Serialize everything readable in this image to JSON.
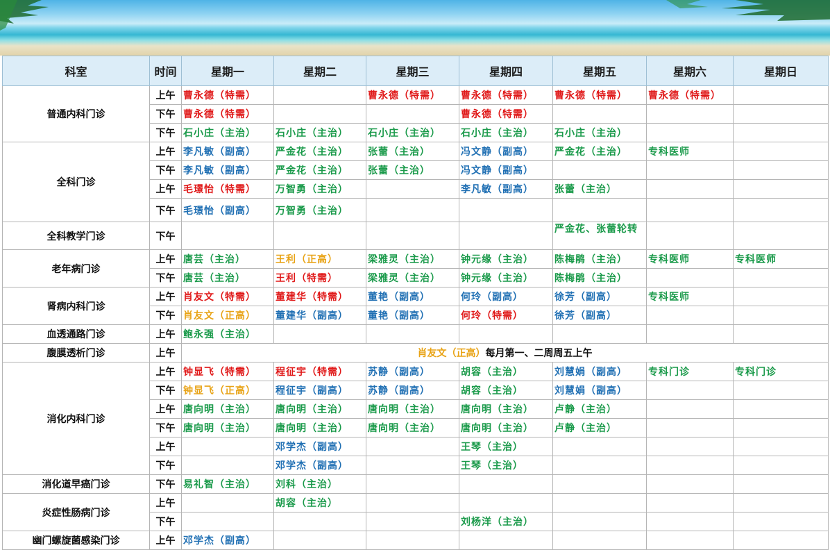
{
  "colors": {
    "red": "#e01818",
    "blue": "#1f6fb3",
    "green": "#1a9a4a",
    "orange": "#e8a315",
    "header_bg": "#dcedf8"
  },
  "headers": [
    "科室",
    "时间",
    "星期一",
    "星期二",
    "星期三",
    "星期四",
    "星期五",
    "星期六",
    "星期日"
  ],
  "rows": [
    {
      "dept": "普通内科门诊",
      "span": 3,
      "h": 27,
      "time": "上午",
      "cells": [
        {
          "t": "曹永德（特需）",
          "c": "red"
        },
        {
          "t": "",
          "c": ""
        },
        {
          "t": "曹永德（特需）",
          "c": "red"
        },
        {
          "t": "曹永德（特需）",
          "c": "red"
        },
        {
          "t": "曹永德（特需）",
          "c": "red"
        },
        {
          "t": "曹永德（特需）",
          "c": "red"
        },
        {
          "t": "",
          "c": ""
        }
      ]
    },
    {
      "h": 27,
      "time": "下午",
      "cells": [
        {
          "t": "曹永德（特需）",
          "c": "red"
        },
        {
          "t": "",
          "c": ""
        },
        {
          "t": "",
          "c": ""
        },
        {
          "t": "曹永德（特需）",
          "c": "red"
        },
        {
          "t": "",
          "c": ""
        },
        {
          "t": "",
          "c": ""
        },
        {
          "t": "",
          "c": ""
        }
      ]
    },
    {
      "h": 27,
      "time": "下午",
      "cells": [
        {
          "t": "石小庄（主治）",
          "c": "green"
        },
        {
          "t": "石小庄（主治）",
          "c": "green"
        },
        {
          "t": "石小庄（主治）",
          "c": "green"
        },
        {
          "t": "石小庄（主治）",
          "c": "green"
        },
        {
          "t": "石小庄（主治）",
          "c": "green"
        },
        {
          "t": "",
          "c": ""
        },
        {
          "t": "",
          "c": ""
        }
      ]
    },
    {
      "dept": "全科门诊",
      "span": 4,
      "h": 27,
      "time": "上午",
      "cells": [
        {
          "t": "李凡敏（副高）",
          "c": "blue"
        },
        {
          "t": "严金花（主治）",
          "c": "green"
        },
        {
          "t": "张蕾（主治）",
          "c": "green"
        },
        {
          "t": "冯文静（副高）",
          "c": "blue"
        },
        {
          "t": "严金花（主治）",
          "c": "green"
        },
        {
          "t": "专科医师",
          "c": "green"
        },
        {
          "t": "",
          "c": ""
        }
      ]
    },
    {
      "h": 27,
      "time": "下午",
      "cells": [
        {
          "t": "李凡敏（副高）",
          "c": "blue"
        },
        {
          "t": "严金花（主治）",
          "c": "green"
        },
        {
          "t": "张蕾（主治）",
          "c": "green"
        },
        {
          "t": "冯文静（副高）",
          "c": "blue"
        },
        {
          "t": "",
          "c": ""
        },
        {
          "t": "",
          "c": ""
        },
        {
          "t": "",
          "c": ""
        }
      ]
    },
    {
      "h": 27,
      "time": "上午",
      "cells": [
        {
          "t": "毛璟怡（特需）",
          "c": "red"
        },
        {
          "t": "万智勇（主治）",
          "c": "green"
        },
        {
          "t": "",
          "c": ""
        },
        {
          "t": "李凡敏（副高）",
          "c": "blue"
        },
        {
          "t": "张蕾（主治）",
          "c": "green"
        },
        {
          "t": "",
          "c": ""
        },
        {
          "t": "",
          "c": ""
        }
      ]
    },
    {
      "h": 34,
      "time": "下午",
      "cells": [
        {
          "t": "毛璟怡（副高）",
          "c": "blue"
        },
        {
          "t": "万智勇（主治）",
          "c": "green"
        },
        {
          "t": "",
          "c": ""
        },
        {
          "t": "",
          "c": ""
        },
        {
          "t": "",
          "c": ""
        },
        {
          "t": "",
          "c": ""
        },
        {
          "t": "",
          "c": ""
        }
      ]
    },
    {
      "dept": "全科教学门诊",
      "span": 1,
      "h": 40,
      "time": "下午",
      "cells": [
        {
          "t": "",
          "c": ""
        },
        {
          "t": "",
          "c": ""
        },
        {
          "t": "",
          "c": ""
        },
        {
          "t": "",
          "c": ""
        },
        {
          "t": "严金花、张蕾轮转",
          "c": "green",
          "wrap": true
        },
        {
          "t": "",
          "c": ""
        },
        {
          "t": "",
          "c": ""
        }
      ]
    },
    {
      "dept": "老年病门诊",
      "span": 2,
      "h": 27,
      "time": "上午",
      "cells": [
        {
          "t": "唐芸（主治）",
          "c": "green"
        },
        {
          "t": "王利（正高）",
          "c": "orange"
        },
        {
          "t": "梁雅灵（主治）",
          "c": "green"
        },
        {
          "t": "钟元缘（主治）",
          "c": "green"
        },
        {
          "t": "陈梅鹃（主治）",
          "c": "green"
        },
        {
          "t": "专科医师",
          "c": "green"
        },
        {
          "t": "专科医师",
          "c": "green"
        }
      ]
    },
    {
      "h": 27,
      "time": "下午",
      "cells": [
        {
          "t": "唐芸（主治）",
          "c": "green"
        },
        {
          "t": "王利（特需）",
          "c": "red"
        },
        {
          "t": "梁雅灵（主治）",
          "c": "green"
        },
        {
          "t": "钟元缘（主治）",
          "c": "green"
        },
        {
          "t": "陈梅鹃（主治）",
          "c": "green"
        },
        {
          "t": "",
          "c": ""
        },
        {
          "t": "",
          "c": ""
        }
      ]
    },
    {
      "dept": "肾病内科门诊",
      "span": 2,
      "h": 27,
      "time": "上午",
      "cells": [
        {
          "t": "肖友文（特需）",
          "c": "red"
        },
        {
          "t": "董建华（特需）",
          "c": "red"
        },
        {
          "t": "董艳（副高）",
          "c": "blue"
        },
        {
          "t": "何玲（副高）",
          "c": "blue"
        },
        {
          "t": "徐芳（副高）",
          "c": "blue"
        },
        {
          "t": "专科医师",
          "c": "green"
        },
        {
          "t": "",
          "c": ""
        }
      ]
    },
    {
      "h": 27,
      "time": "下午",
      "cells": [
        {
          "t": "肖友文（正高）",
          "c": "orange"
        },
        {
          "t": "董建华（副高）",
          "c": "blue"
        },
        {
          "t": "董艳（副高）",
          "c": "blue"
        },
        {
          "t": "何玲（特需）",
          "c": "red"
        },
        {
          "t": "徐芳（副高）",
          "c": "blue"
        },
        {
          "t": "",
          "c": ""
        },
        {
          "t": "",
          "c": ""
        }
      ]
    },
    {
      "dept": "血透通路门诊",
      "span": 1,
      "h": 27,
      "time": "上午",
      "cells": [
        {
          "t": "鲍永强（主治）",
          "c": "green"
        },
        {
          "t": "",
          "c": ""
        },
        {
          "t": "",
          "c": ""
        },
        {
          "t": "",
          "c": ""
        },
        {
          "t": "",
          "c": ""
        },
        {
          "t": "",
          "c": ""
        },
        {
          "t": "",
          "c": ""
        }
      ]
    },
    {
      "dept": "腹膜透析门诊",
      "span": 1,
      "h": 27,
      "time": "上午",
      "merged": {
        "a": "肖友文（正高）",
        "b": "每月第一、二周周五上午"
      }
    },
    {
      "dept": "消化内科门诊",
      "span": 6,
      "h": 27,
      "time": "上午",
      "cells": [
        {
          "t": "钟显飞（特需）",
          "c": "red"
        },
        {
          "t": "程征宇（特需）",
          "c": "red"
        },
        {
          "t": "苏静（副高）",
          "c": "blue"
        },
        {
          "t": "胡容（主治）",
          "c": "green"
        },
        {
          "t": "刘慧娟（副高）",
          "c": "blue"
        },
        {
          "t": "专科门诊",
          "c": "green"
        },
        {
          "t": "专科门诊",
          "c": "green"
        }
      ]
    },
    {
      "h": 27,
      "time": "下午",
      "cells": [
        {
          "t": "钟显飞（正高）",
          "c": "orange"
        },
        {
          "t": "程征宇（副高）",
          "c": "blue"
        },
        {
          "t": "苏静（副高）",
          "c": "blue"
        },
        {
          "t": "胡容（主治）",
          "c": "green"
        },
        {
          "t": "刘慧娟（副高）",
          "c": "blue"
        },
        {
          "t": "",
          "c": ""
        },
        {
          "t": "",
          "c": ""
        }
      ]
    },
    {
      "h": 27,
      "time": "上午",
      "cells": [
        {
          "t": "唐向明（主治）",
          "c": "green"
        },
        {
          "t": "唐向明（主治）",
          "c": "green"
        },
        {
          "t": "唐向明（主治）",
          "c": "green"
        },
        {
          "t": "唐向明（主治）",
          "c": "green"
        },
        {
          "t": "卢静（主治）",
          "c": "green"
        },
        {
          "t": "",
          "c": ""
        },
        {
          "t": "",
          "c": ""
        }
      ]
    },
    {
      "h": 27,
      "time": "下午",
      "cells": [
        {
          "t": "唐向明（主治）",
          "c": "green"
        },
        {
          "t": "唐向明（主治）",
          "c": "green"
        },
        {
          "t": "唐向明（主治）",
          "c": "green"
        },
        {
          "t": "唐向明（主治）",
          "c": "green"
        },
        {
          "t": "卢静（主治）",
          "c": "green"
        },
        {
          "t": "",
          "c": ""
        },
        {
          "t": "",
          "c": ""
        }
      ]
    },
    {
      "h": 27,
      "time": "上午",
      "cells": [
        {
          "t": "",
          "c": ""
        },
        {
          "t": "邓学杰（副高）",
          "c": "blue"
        },
        {
          "t": "",
          "c": ""
        },
        {
          "t": "王琴（主治）",
          "c": "green"
        },
        {
          "t": "",
          "c": ""
        },
        {
          "t": "",
          "c": ""
        },
        {
          "t": "",
          "c": ""
        }
      ]
    },
    {
      "h": 27,
      "time": "下午",
      "cells": [
        {
          "t": "",
          "c": ""
        },
        {
          "t": "邓学杰（副高）",
          "c": "blue"
        },
        {
          "t": "",
          "c": ""
        },
        {
          "t": "王琴（主治）",
          "c": "green"
        },
        {
          "t": "",
          "c": ""
        },
        {
          "t": "",
          "c": ""
        },
        {
          "t": "",
          "c": ""
        }
      ]
    },
    {
      "dept": "消化道早癌门诊",
      "span": 1,
      "h": 27,
      "time": "下午",
      "cells": [
        {
          "t": "易礼智（主治）",
          "c": "green"
        },
        {
          "t": "刘科（主治）",
          "c": "green"
        },
        {
          "t": "",
          "c": ""
        },
        {
          "t": "",
          "c": ""
        },
        {
          "t": "",
          "c": ""
        },
        {
          "t": "",
          "c": ""
        },
        {
          "t": "",
          "c": ""
        }
      ]
    },
    {
      "dept": "炎症性肠病门诊",
      "span": 2,
      "h": 27,
      "time": "上午",
      "cells": [
        {
          "t": "",
          "c": ""
        },
        {
          "t": "胡容（主治）",
          "c": "green"
        },
        {
          "t": "",
          "c": ""
        },
        {
          "t": "",
          "c": ""
        },
        {
          "t": "",
          "c": ""
        },
        {
          "t": "",
          "c": ""
        },
        {
          "t": "",
          "c": ""
        }
      ]
    },
    {
      "h": 27,
      "time": "下午",
      "cells": [
        {
          "t": "",
          "c": ""
        },
        {
          "t": "",
          "c": ""
        },
        {
          "t": "",
          "c": ""
        },
        {
          "t": "刘杨洋（主治）",
          "c": "green"
        },
        {
          "t": "",
          "c": ""
        },
        {
          "t": "",
          "c": ""
        },
        {
          "t": "",
          "c": ""
        }
      ]
    },
    {
      "dept": "幽门螺旋菌感染门诊",
      "span": 1,
      "h": 27,
      "time": "上午",
      "cells": [
        {
          "t": "邓学杰（副高）",
          "c": "blue"
        },
        {
          "t": "",
          "c": ""
        },
        {
          "t": "",
          "c": ""
        },
        {
          "t": "",
          "c": ""
        },
        {
          "t": "",
          "c": ""
        },
        {
          "t": "",
          "c": ""
        },
        {
          "t": "",
          "c": ""
        }
      ]
    }
  ]
}
